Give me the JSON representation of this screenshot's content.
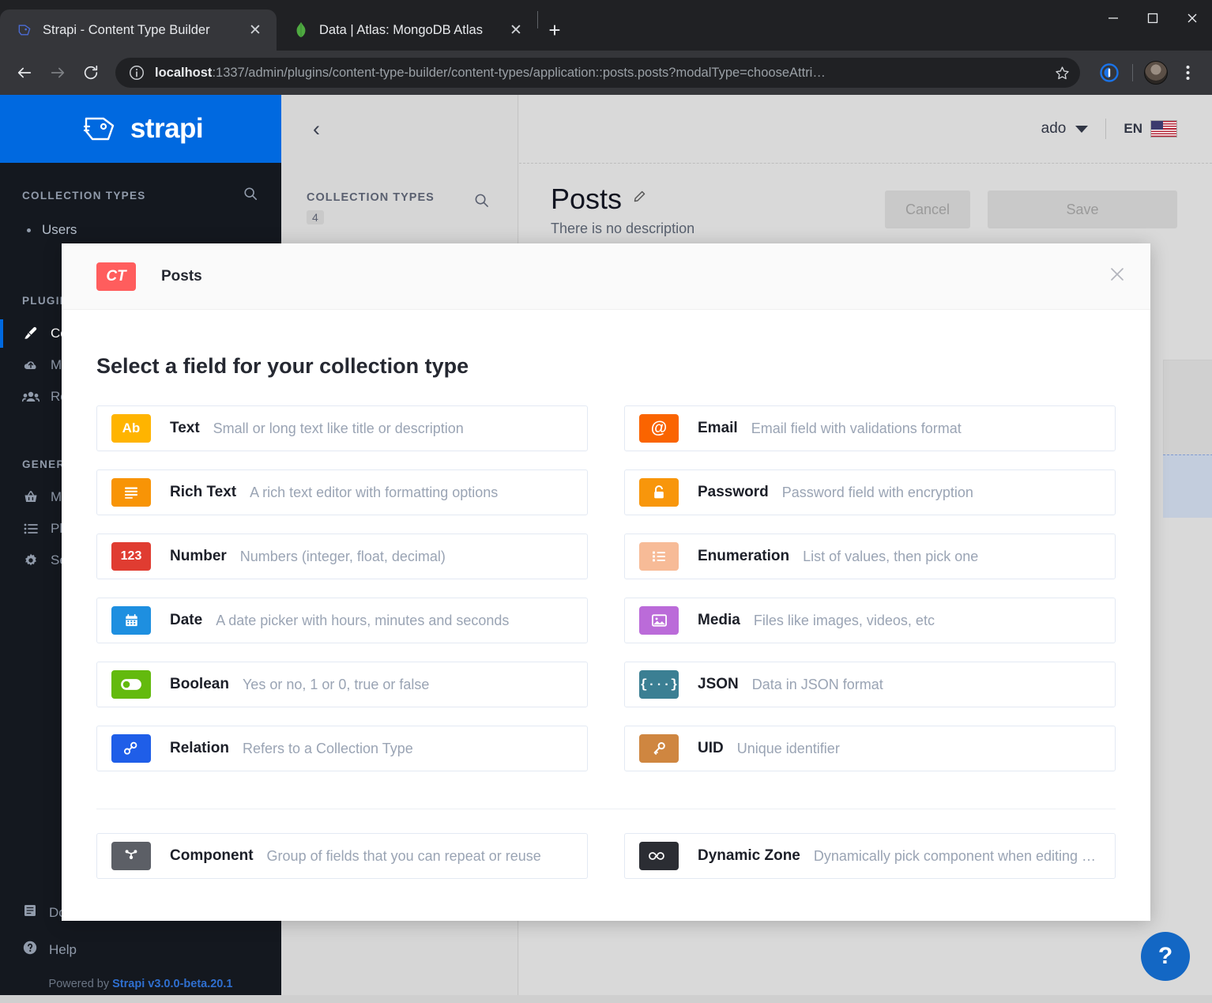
{
  "browser": {
    "tabs": [
      {
        "title": "Strapi - Content Type Builder",
        "favicon": "strapi-icon",
        "active": true
      },
      {
        "title": "Data | Atlas: MongoDB Atlas",
        "favicon": "mongodb-leaf-icon",
        "active": false
      }
    ],
    "newtab_label": "+",
    "close_label": "✕",
    "window_controls": {
      "minimize": "—",
      "maximize": "☐",
      "close": "✕"
    },
    "url_host": "localhost",
    "url_rest": ":1337/admin/plugins/content-type-builder/content-types/application::posts.posts?modalType=chooseAttri…",
    "nav": {
      "back": "←",
      "forward": "→",
      "reload": "⟳"
    }
  },
  "sidebar": {
    "brand": "strapi",
    "collection_types_title": "COLLECTION TYPES",
    "collection_items": [
      {
        "label": "Users"
      }
    ],
    "plugins_title": "PLUGINS",
    "plugin_items": [
      {
        "label": "Content-Type Builder",
        "icon": "brush-icon",
        "active": true
      },
      {
        "label": "Media Library",
        "icon": "cloud-upload-icon",
        "active": false
      },
      {
        "label": "Roles & Permissions",
        "icon": "users-icon",
        "active": false
      }
    ],
    "general_title": "GENERAL",
    "general_items": [
      {
        "label": "Marketplace",
        "icon": "basket-icon"
      },
      {
        "label": "Plugins",
        "icon": "list-icon"
      },
      {
        "label": "Settings",
        "icon": "gear-icon"
      }
    ],
    "footer_items": [
      {
        "label": "Documentation",
        "icon": "book-icon"
      },
      {
        "label": "Help",
        "icon": "question-circle-icon"
      }
    ],
    "powered_by": "Powered by",
    "version": "Strapi v3.0.0-beta.20.1"
  },
  "middle_column": {
    "title": "COLLECTION TYPES",
    "count": "4",
    "search_icon": "search-icon",
    "back_chevron": "‹"
  },
  "header": {
    "user": "ado",
    "language": "EN",
    "flag": "us-flag-icon"
  },
  "page": {
    "title": "Posts",
    "edit_icon": "pencil-icon",
    "description": "There is no description",
    "cancel_label": "Cancel",
    "save_label": "Save"
  },
  "help": {
    "label": "?"
  },
  "modal": {
    "content_type_badge": "CT",
    "content_type_name": "Posts",
    "close_label": "✕",
    "heading": "Select a field for your collection type",
    "fields_left": [
      {
        "name": "Text",
        "desc": "Small or long text like title or description",
        "icon_text": "Ab",
        "icon_glyph": "",
        "color": "#ffb400",
        "icon_name": "text-field-icon"
      },
      {
        "name": "Rich Text",
        "desc": "A rich text editor with formatting options",
        "icon_text": "",
        "icon_glyph": "lines",
        "color": "#f89406",
        "icon_name": "rich-text-icon"
      },
      {
        "name": "Number",
        "desc": "Numbers (integer, float, decimal)",
        "icon_text": "123",
        "icon_glyph": "",
        "color": "#e03c31",
        "icon_name": "number-field-icon"
      },
      {
        "name": "Date",
        "desc": "A date picker with hours, minutes and seconds",
        "icon_text": "",
        "icon_glyph": "calendar",
        "color": "#1e8fe0",
        "icon_name": "date-field-icon"
      },
      {
        "name": "Boolean",
        "desc": "Yes or no, 1 or 0, true or false",
        "icon_text": "",
        "icon_glyph": "toggle",
        "color": "#63ba0e",
        "icon_name": "boolean-field-icon"
      },
      {
        "name": "Relation",
        "desc": "Refers to a Collection Type",
        "icon_text": "",
        "icon_glyph": "link",
        "color": "#1f5ee8",
        "icon_name": "relation-field-icon"
      }
    ],
    "fields_right": [
      {
        "name": "Email",
        "desc": "Email field with validations format",
        "icon_text": "@",
        "icon_glyph": "",
        "color": "#fa6400",
        "icon_name": "email-field-icon"
      },
      {
        "name": "Password",
        "desc": "Password field with encryption",
        "icon_text": "",
        "icon_glyph": "lock",
        "color": "#f8960b",
        "icon_name": "password-field-icon"
      },
      {
        "name": "Enumeration",
        "desc": "List of values, then pick one",
        "icon_text": "",
        "icon_glyph": "bullets",
        "color": "#f7bb97",
        "icon_name": "enumeration-field-icon"
      },
      {
        "name": "Media",
        "desc": "Files like images, videos, etc",
        "icon_text": "",
        "icon_glyph": "image",
        "color": "#bb6bd9",
        "icon_name": "media-field-icon"
      },
      {
        "name": "JSON",
        "desc": "Data in JSON format",
        "icon_text": "{···}",
        "icon_glyph": "",
        "color": "#3b7f93",
        "icon_name": "json-field-icon"
      },
      {
        "name": "UID",
        "desc": "Unique identifier",
        "icon_text": "",
        "icon_glyph": "key",
        "color": "#cf8640",
        "icon_name": "uid-field-icon"
      }
    ],
    "fields_bottom": [
      {
        "name": "Component",
        "desc": "Group of fields that you can repeat or reuse",
        "icon_text": "",
        "icon_glyph": "component",
        "color": "#5c5f66",
        "icon_name": "component-field-icon"
      },
      {
        "name": "Dynamic Zone",
        "desc": "Dynamically pick component when editing …",
        "icon_text": "",
        "icon_glyph": "infinity",
        "color": "#2b2d33",
        "icon_name": "dynamic-zone-field-icon"
      }
    ]
  },
  "colors": {
    "strapi_blue": "#0069e0",
    "sidebar_dark": "#14181f",
    "accent_red": "#ff5d5d"
  }
}
